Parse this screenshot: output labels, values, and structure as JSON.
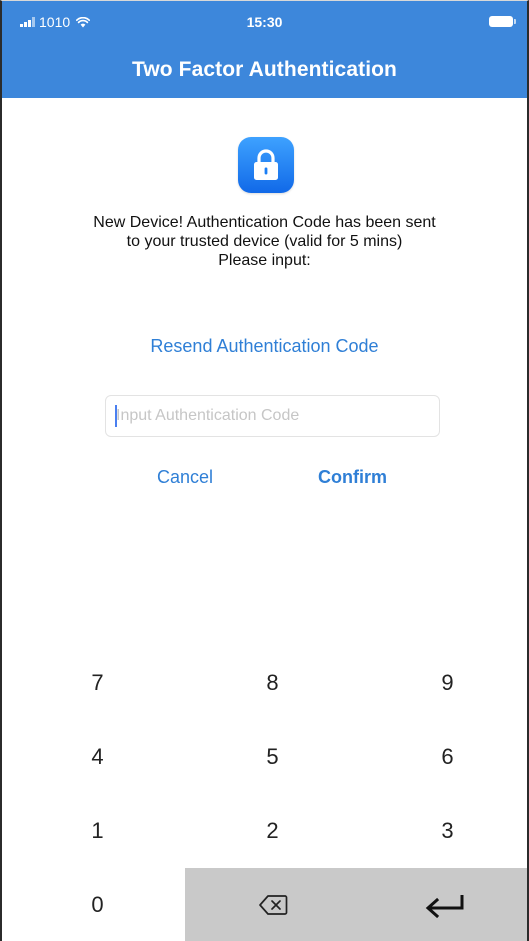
{
  "status_bar": {
    "carrier": "1010",
    "time": "15:30"
  },
  "header": {
    "title": "Two Factor Authentication"
  },
  "message": {
    "lines": [
      "New Device! Authentication Code has been sent",
      "to your trusted device (valid for 5 mins)",
      "Please input:"
    ]
  },
  "resend": {
    "label": "Resend Authentication Code"
  },
  "code_input": {
    "value": "",
    "placeholder": "Input Authentication Code"
  },
  "actions": {
    "cancel_label": "Cancel",
    "confirm_label": "Confirm"
  },
  "keypad": {
    "keys": [
      "7",
      "8",
      "9",
      "4",
      "5",
      "6",
      "1",
      "2",
      "3",
      "0"
    ]
  },
  "colors": {
    "header": "#3d87db",
    "link": "#2f7fd6",
    "keypad_special": "#c9c9c9",
    "lock_icon": "#1a7ef5"
  },
  "icons": {
    "app": "lock-icon",
    "delete": "backspace-icon",
    "enter": "return-icon"
  }
}
